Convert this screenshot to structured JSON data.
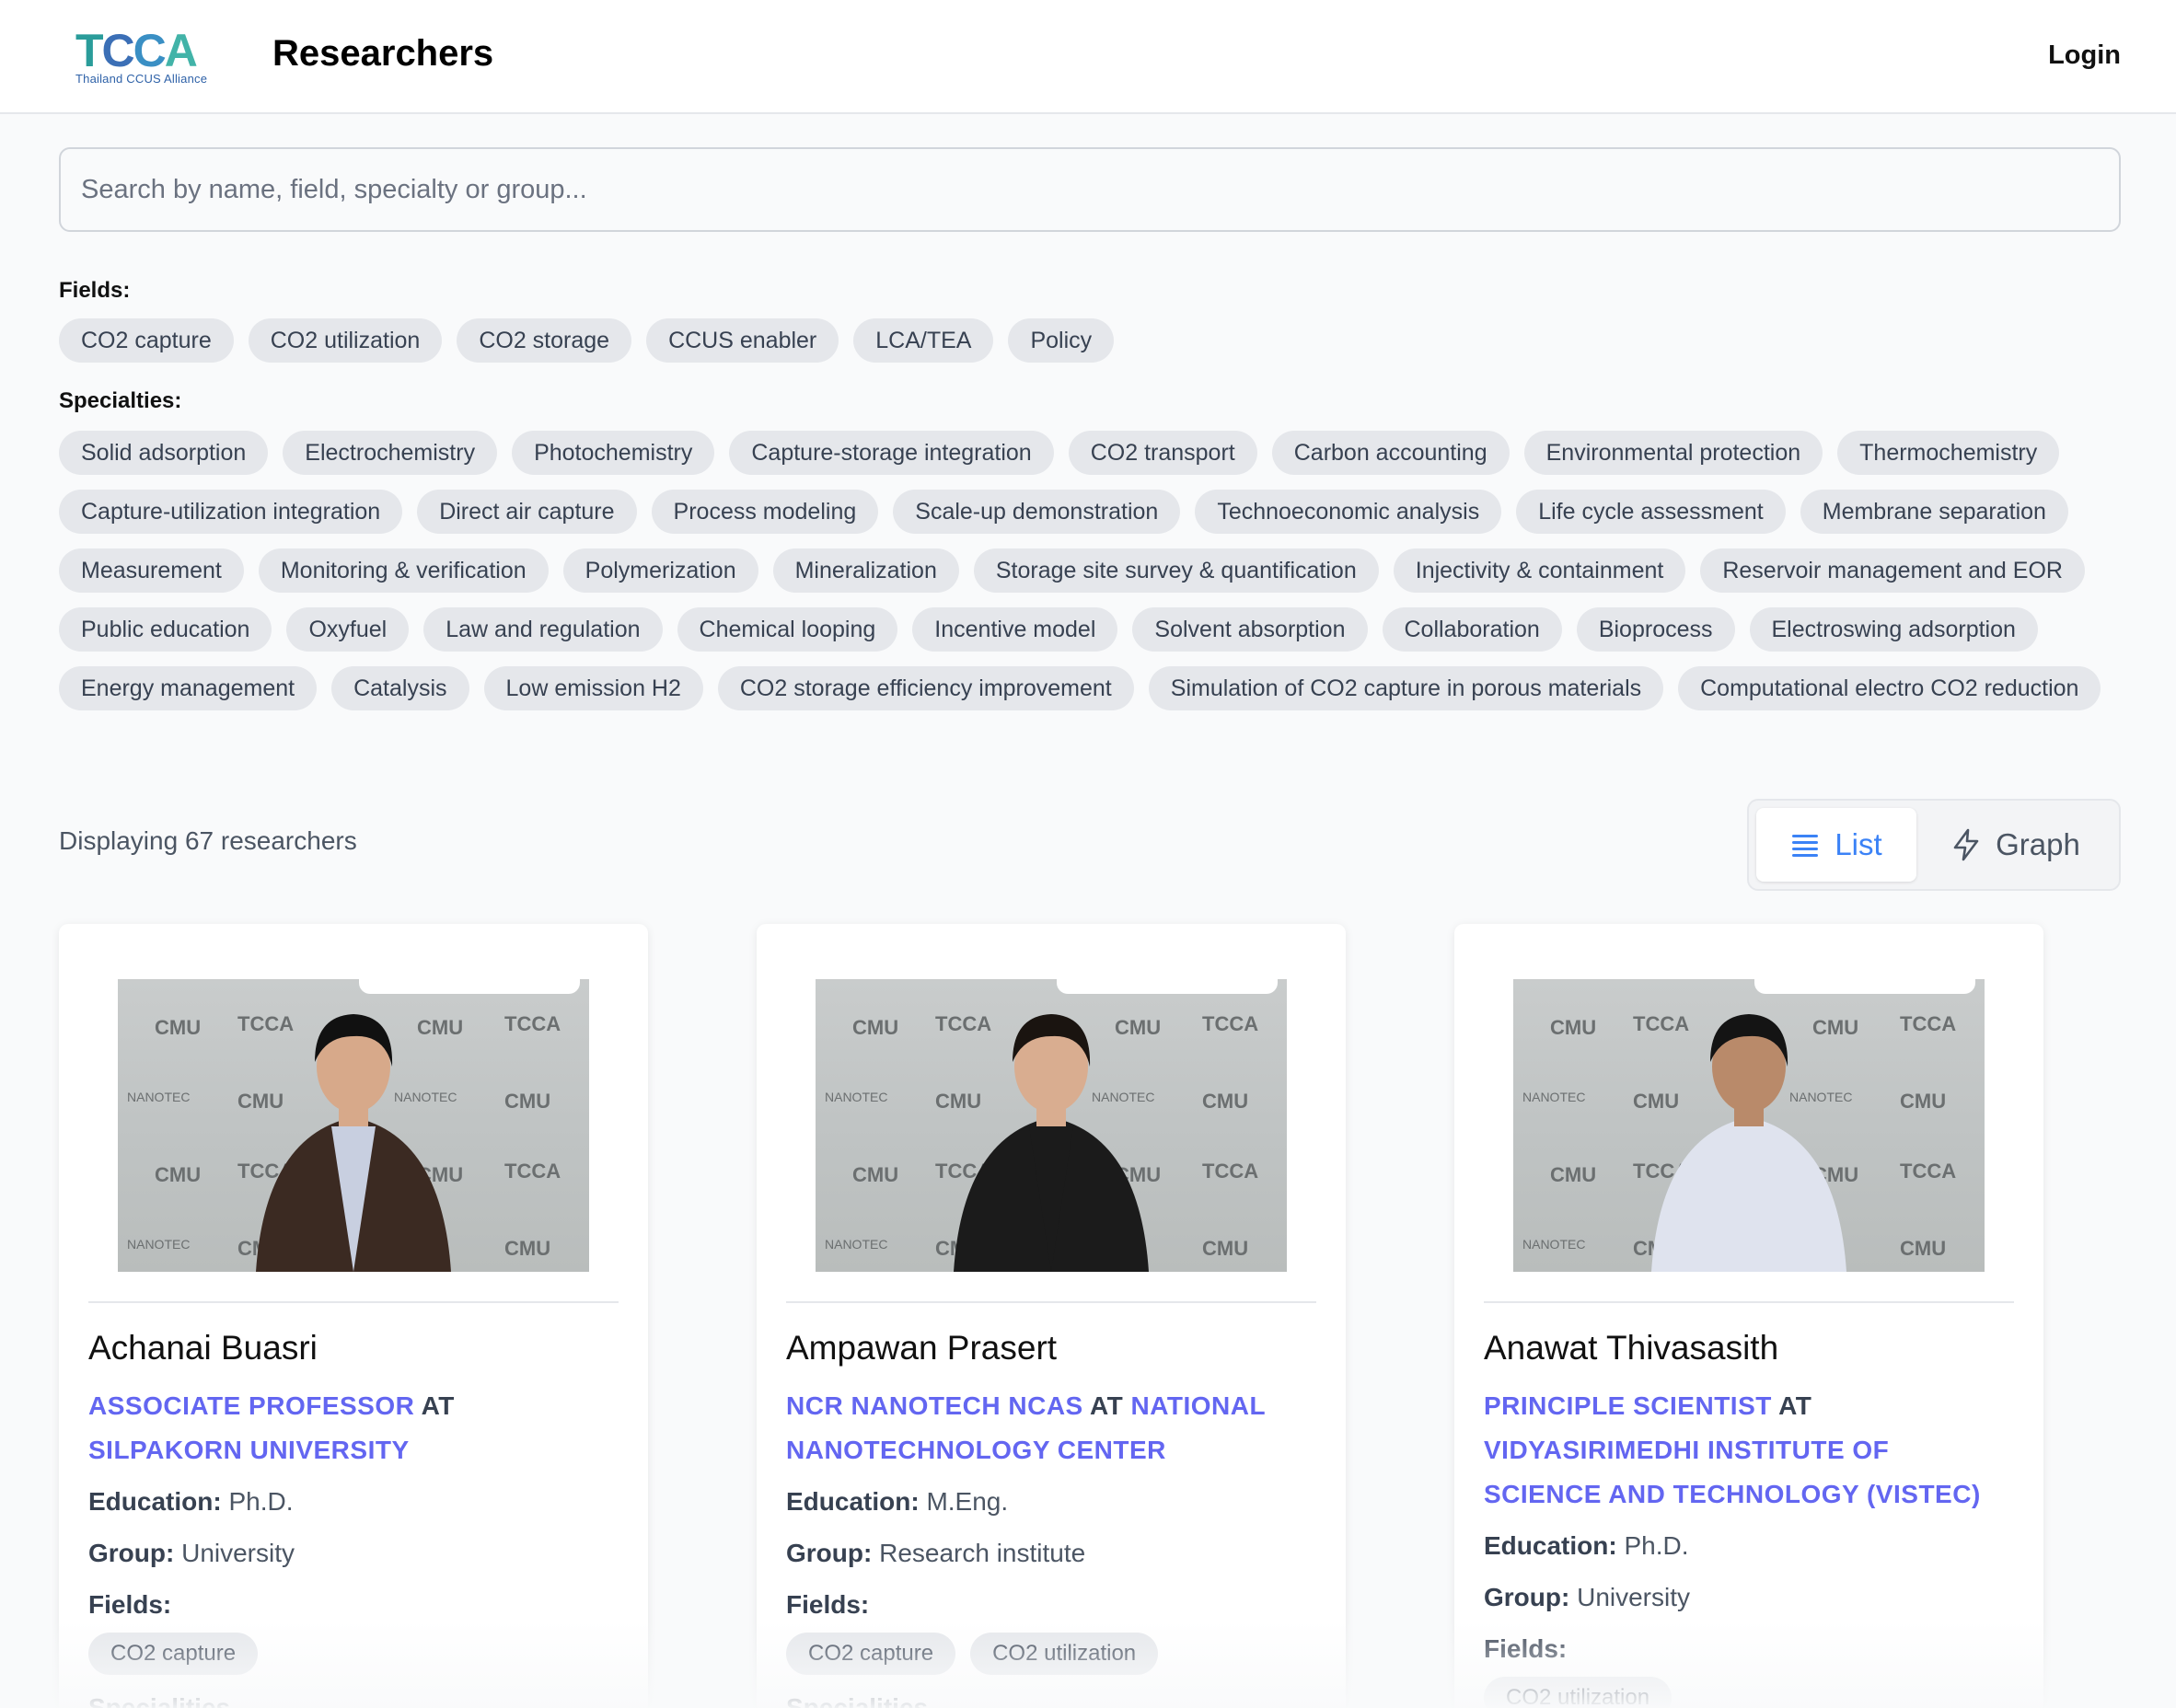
{
  "header": {
    "logo_text": "TCCA",
    "logo_subtitle": "Thailand CCUS Alliance",
    "title": "Researchers",
    "login_label": "Login"
  },
  "search": {
    "placeholder": "Search by name, field, specialty or group...",
    "value": ""
  },
  "fields": {
    "label": "Fields:",
    "items": [
      "CO2 capture",
      "CO2 utilization",
      "CO2 storage",
      "CCUS enabler",
      "LCA/TEA",
      "Policy"
    ]
  },
  "specialties": {
    "label": "Specialties:",
    "items": [
      "Solid adsorption",
      "Electrochemistry",
      "Photochemistry",
      "Capture-storage integration",
      "CO2 transport",
      "Carbon accounting",
      "Environmental protection",
      "Thermochemistry",
      "Capture-utilization integration",
      "Direct air capture",
      "Process modeling",
      "Scale-up demonstration",
      "Technoeconomic analysis",
      "Life cycle assessment",
      "Membrane separation",
      "Measurement",
      "Monitoring & verification",
      "Polymerization",
      "Mineralization",
      "Storage site survey & quantification",
      "Injectivity & containment",
      "Reservoir management and EOR",
      "Public education",
      "Oxyfuel",
      "Law and regulation",
      "Chemical looping",
      "Incentive model",
      "Solvent absorption",
      "Collaboration",
      "Bioprocess",
      "Electroswing adsorption",
      "Energy management",
      "Catalysis",
      "Low emission H2",
      "CO2 storage efficiency improvement",
      "Simulation of CO2 capture in porous materials",
      "Computational electro CO2 reduction"
    ]
  },
  "results": {
    "summary": "Displaying 67 researchers"
  },
  "view_toggle": {
    "list_label": "List",
    "graph_label": "Graph",
    "active": "list"
  },
  "labels": {
    "education": "Education:",
    "group": "Group:",
    "fields": "Fields:",
    "at": "AT",
    "specialties": "Specialities"
  },
  "photo_logos": {
    "cmu": "CMU",
    "tcca": "TCCA",
    "nanotec": "NANOTEC"
  },
  "researchers": [
    {
      "name": "Achanai Buasri",
      "position": "ASSOCIATE PROFESSOR",
      "organization": "SILPAKORN UNIVERSITY",
      "education": "Ph.D.",
      "group": "University",
      "fields": [
        "CO2 capture"
      ]
    },
    {
      "name": "Ampawan Prasert",
      "position": "NCR NANOTECH NCAS",
      "organization": "NATIONAL NANOTECHNOLOGY CENTER",
      "education": "M.Eng.",
      "group": "Research institute",
      "fields": [
        "CO2 capture",
        "CO2 utilization"
      ]
    },
    {
      "name": "Anawat Thivasasith",
      "position": "PRINCIPLE SCIENTIST",
      "organization": "VIDYASIRIMEDHI INSTITUTE OF SCIENCE AND TECHNOLOGY (VISTEC)",
      "education": "Ph.D.",
      "group": "University",
      "fields": [
        "CO2 utilization"
      ]
    }
  ],
  "colors": {
    "accent": "#6366f1",
    "toggle_active": "#3b82f6",
    "chip_bg": "#e5e7eb"
  }
}
